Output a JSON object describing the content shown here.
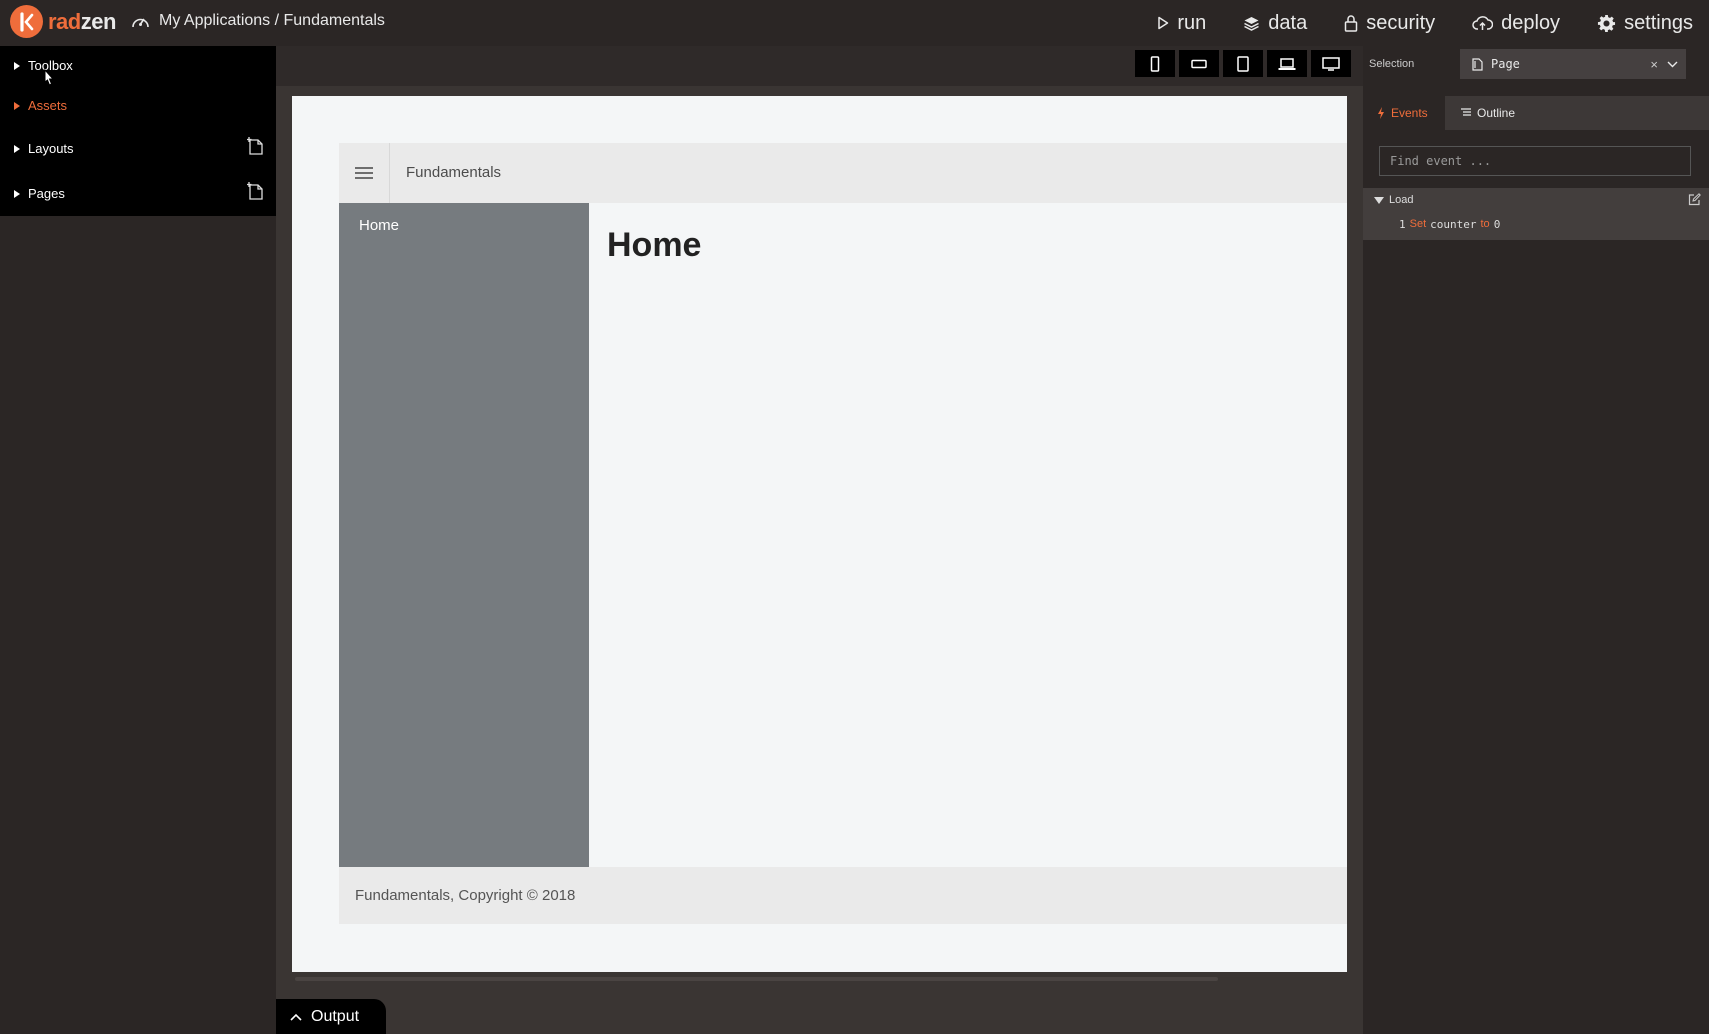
{
  "app": {
    "logo_rad": "rad",
    "logo_zen": "zen",
    "breadcrumb": "My Applications / Fundamentals"
  },
  "topnav": [
    {
      "label": "run",
      "icon": "play-icon"
    },
    {
      "label": "data",
      "icon": "layers-icon"
    },
    {
      "label": "security",
      "icon": "lock-icon"
    },
    {
      "label": "deploy",
      "icon": "cloud-upload-icon"
    },
    {
      "label": "settings",
      "icon": "gear-icon"
    }
  ],
  "sidebar": {
    "items": [
      {
        "label": "Toolbox"
      },
      {
        "label": "Assets"
      },
      {
        "label": "Layouts"
      },
      {
        "label": "Pages"
      }
    ]
  },
  "canvas": {
    "header_title": "Fundamentals",
    "nav_home": "Home",
    "page_heading": "Home",
    "footer": "Fundamentals, Copyright © 2018"
  },
  "output": {
    "label": "Output"
  },
  "rightpanel": {
    "selection_label": "Selection",
    "selection_value": "Page",
    "selection_clear": "×",
    "tabs": [
      {
        "label": "Events"
      },
      {
        "label": "Outline"
      }
    ],
    "find_placeholder": "Find event ...",
    "event_name": "Load",
    "action": {
      "index": "1",
      "keyword": "Set",
      "variable": "counter",
      "to": "to",
      "value": "0"
    }
  },
  "colors": {
    "accent": "#ef6d3b",
    "topbar": "#2b2625",
    "sidebar_nav": "#767b7f"
  }
}
